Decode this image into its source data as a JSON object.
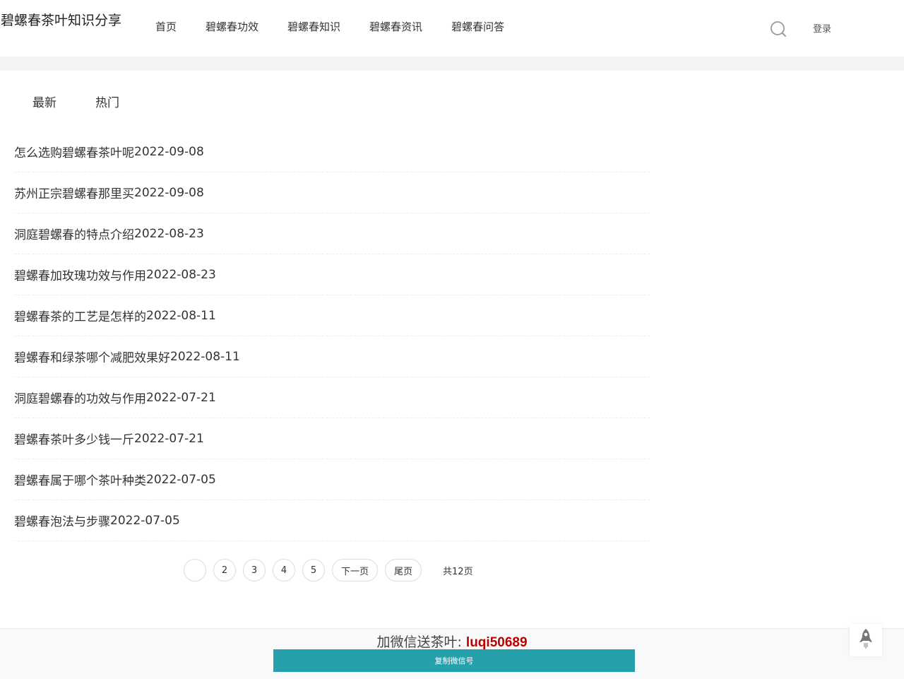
{
  "site": {
    "title": "碧螺春茶叶知识分享"
  },
  "nav": [
    {
      "label": "首页"
    },
    {
      "label": "碧螺春功效"
    },
    {
      "label": "碧螺春知识"
    },
    {
      "label": "碧螺春资讯"
    },
    {
      "label": "碧螺春问答"
    }
  ],
  "header": {
    "search_icon": "search-icon",
    "login_label": "登录"
  },
  "tabs": [
    {
      "label": "最新"
    },
    {
      "label": "热门"
    }
  ],
  "articles": [
    {
      "title": "怎么选购碧螺春茶叶呢",
      "date": "2022-09-08"
    },
    {
      "title": "苏州正宗碧螺春那里买",
      "date": "2022-09-08"
    },
    {
      "title": "洞庭碧螺春的特点介绍",
      "date": "2022-08-23"
    },
    {
      "title": "碧螺春加玫瑰功效与作用",
      "date": "2022-08-23"
    },
    {
      "title": "碧螺春茶的工艺是怎样的",
      "date": "2022-08-11"
    },
    {
      "title": "碧螺春和绿茶哪个减肥效果好",
      "date": "2022-08-11"
    },
    {
      "title": "洞庭碧螺春的功效与作用",
      "date": "2022-07-21"
    },
    {
      "title": "碧螺春茶叶多少钱一斤",
      "date": "2022-07-21"
    },
    {
      "title": "碧螺春属于哪个茶叶种类",
      "date": "2022-07-05"
    },
    {
      "title": "碧螺春泡法与步骤",
      "date": "2022-07-05"
    }
  ],
  "pagination": {
    "current": "",
    "pages": [
      "2",
      "3",
      "4",
      "5"
    ],
    "next_label": "下一页",
    "last_label": "尾页",
    "total_label": "共12页"
  },
  "footer": {
    "wechat_prefix": "加微信送茶叶: ",
    "wechat_id": "luqi50689",
    "copy_label": "复制微信号",
    "back_to_top_icon": "rocket-icon",
    "accent_color": "#26a0ab",
    "id_color": "#bb0000"
  }
}
